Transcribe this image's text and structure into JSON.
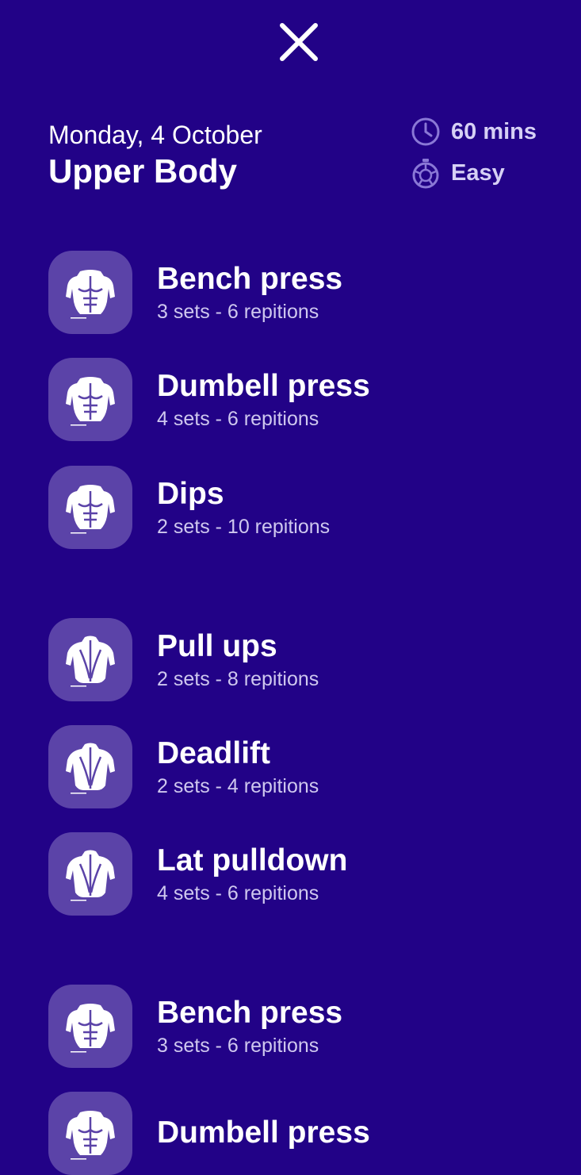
{
  "workout": {
    "date": "Monday, 4 October",
    "title": "Upper Body",
    "duration": "60 mins",
    "difficulty": "Easy"
  },
  "icons": {
    "close": "close-icon",
    "duration": "clock-icon",
    "difficulty": "stopwatch-icon",
    "chest": "chest-muscle-icon",
    "back": "back-muscle-icon"
  },
  "colors": {
    "background": "#220287",
    "thumbnail": "#5b43a8",
    "subtext": "#cfc8ef"
  },
  "exercises": [
    {
      "name": "Bench press",
      "detail": "3 sets - 6 repitions",
      "icon": "chest-muscle-icon"
    },
    {
      "name": "Dumbell press",
      "detail": "4 sets - 6 repitions",
      "icon": "chest-muscle-icon"
    },
    {
      "name": "Dips",
      "detail": "2 sets - 10 repitions",
      "icon": "chest-muscle-icon"
    },
    {
      "name": "Pull ups",
      "detail": "2 sets - 8 repitions",
      "icon": "back-muscle-icon"
    },
    {
      "name": "Deadlift",
      "detail": "2 sets - 4 repitions",
      "icon": "back-muscle-icon"
    },
    {
      "name": "Lat pulldown",
      "detail": "4 sets - 6 repitions",
      "icon": "back-muscle-icon"
    },
    {
      "name": "Bench press",
      "detail": "3 sets - 6 repitions",
      "icon": "chest-muscle-icon"
    },
    {
      "name": "Dumbell press",
      "detail": "",
      "icon": "chest-muscle-icon"
    }
  ]
}
